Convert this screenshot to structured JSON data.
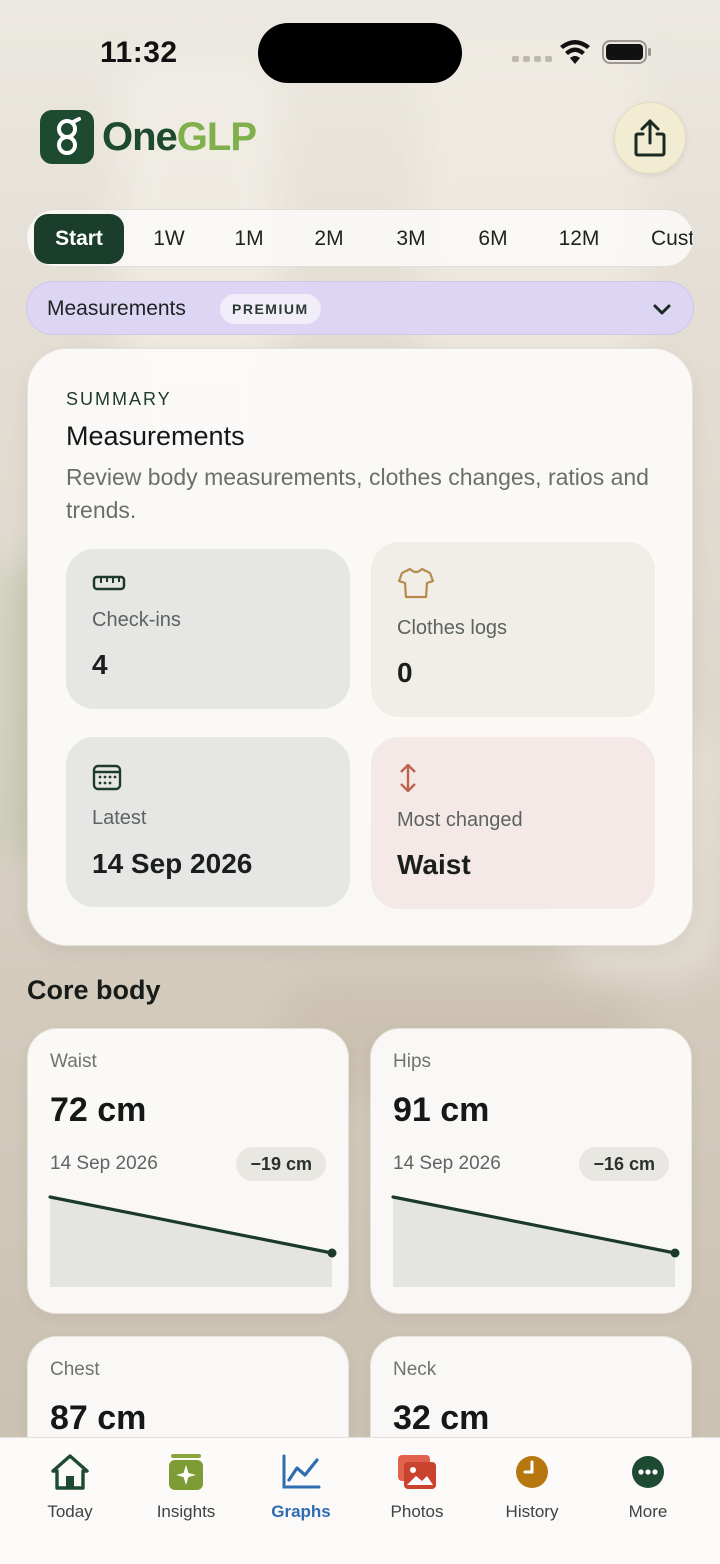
{
  "status_bar": {
    "time": "11:32"
  },
  "header": {
    "logo": {
      "one": "One",
      "glp": "GLP"
    },
    "share_icon": "share-icon"
  },
  "range_tabs": [
    "Start",
    "1W",
    "1M",
    "2M",
    "3M",
    "6M",
    "12M",
    "Cust"
  ],
  "range_selected": "Start",
  "selector": {
    "label": "Measurements",
    "badge": "PREMIUM"
  },
  "summary": {
    "eyebrow": "SUMMARY",
    "title": "Measurements",
    "description": "Review body measurements, clothes changes, ratios and trends.",
    "stats": {
      "checkins": {
        "label": "Check-ins",
        "value": "4",
        "icon": "ruler-icon"
      },
      "clothes": {
        "label": "Clothes logs",
        "value": "0",
        "icon": "shirt-icon"
      },
      "latest": {
        "label": "Latest",
        "value": "14 Sep 2026",
        "icon": "calendar-icon"
      },
      "changed": {
        "label": "Most changed",
        "value": "Waist",
        "icon": "up-down-arrows-icon"
      }
    }
  },
  "core_body": {
    "title": "Core body",
    "cards": {
      "waist": {
        "name": "Waist",
        "value": "72 cm",
        "date": "14 Sep 2026",
        "delta": "−19 cm",
        "trend": [
          91,
          72
        ]
      },
      "hips": {
        "name": "Hips",
        "value": "91 cm",
        "date": "14 Sep 2026",
        "delta": "−16 cm",
        "trend": [
          107,
          91
        ]
      },
      "chest": {
        "name": "Chest",
        "value": "87 cm"
      },
      "neck": {
        "name": "Neck",
        "value": "32 cm"
      }
    }
  },
  "tab_bar": {
    "active": "Graphs",
    "items": [
      {
        "label": "Today",
        "icon": "house-icon"
      },
      {
        "label": "Insights",
        "icon": "sparkle-icon"
      },
      {
        "label": "Graphs",
        "icon": "line-chart-icon"
      },
      {
        "label": "Photos",
        "icon": "photos-icon"
      },
      {
        "label": "History",
        "icon": "clock-icon"
      },
      {
        "label": "More",
        "icon": "more-dots-icon"
      }
    ]
  },
  "colors": {
    "brand_dark": "#1f4a32",
    "brand_light": "#7fb04b",
    "tab_active": "#1b3d2c",
    "premium_bg": "#ddd5f4",
    "graphs_active": "#2f6db0"
  }
}
